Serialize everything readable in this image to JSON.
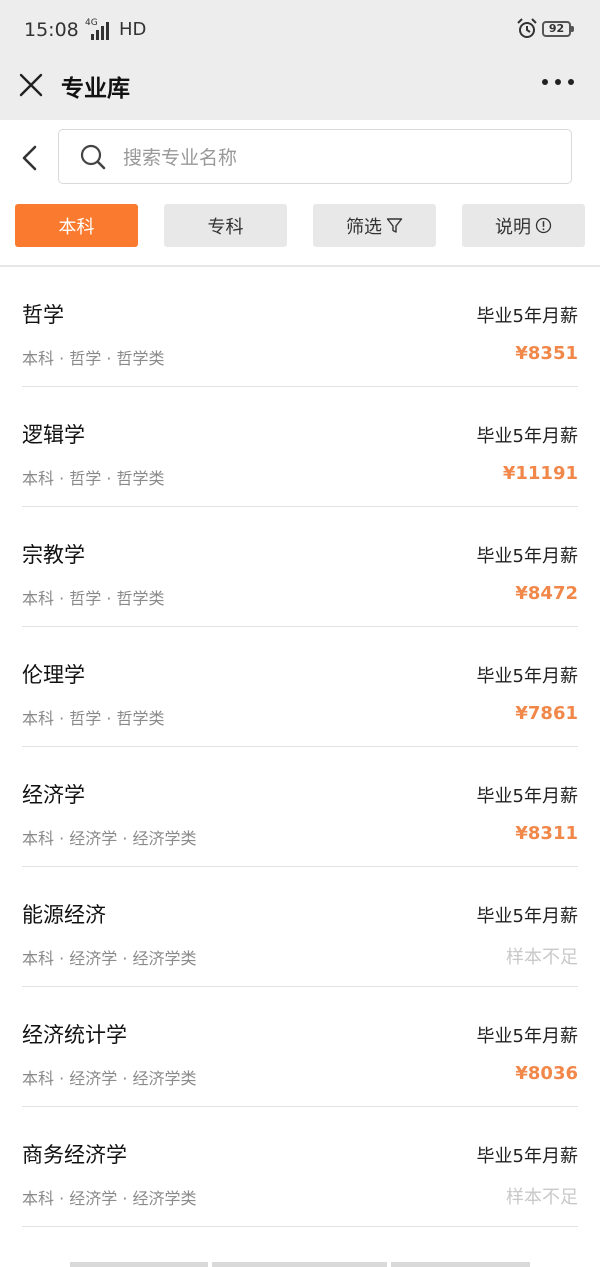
{
  "status_bar": {
    "time": "15:08",
    "network_sup": "4G",
    "network_type": "HD",
    "battery": "92"
  },
  "header": {
    "title": "专业库"
  },
  "search": {
    "placeholder": "搜索专业名称"
  },
  "filters": [
    {
      "label": "本科",
      "active": true
    },
    {
      "label": "专科",
      "active": false
    },
    {
      "label": "筛选",
      "active": false,
      "icon": "funnel-icon"
    },
    {
      "label": "说明",
      "active": false,
      "icon": "info-icon"
    }
  ],
  "majors": [
    {
      "name": "哲学",
      "meta": "本科 · 哲学 · 哲学类",
      "salary_label": "毕业5年月薪",
      "salary": "¥8351"
    },
    {
      "name": "逻辑学",
      "meta": "本科 · 哲学 · 哲学类",
      "salary_label": "毕业5年月薪",
      "salary": "¥11191"
    },
    {
      "name": "宗教学",
      "meta": "本科 · 哲学 · 哲学类",
      "salary_label": "毕业5年月薪",
      "salary": "¥8472"
    },
    {
      "name": "伦理学",
      "meta": "本科 · 哲学 · 哲学类",
      "salary_label": "毕业5年月薪",
      "salary": "¥7861"
    },
    {
      "name": "经济学",
      "meta": "本科 · 经济学 · 经济学类",
      "salary_label": "毕业5年月薪",
      "salary": "¥8311"
    },
    {
      "name": "能源经济",
      "meta": "本科 · 经济学 · 经济学类",
      "salary_label": "毕业5年月薪",
      "salary": "样本不足"
    },
    {
      "name": "经济统计学",
      "meta": "本科 · 经济学 · 经济学类",
      "salary_label": "毕业5年月薪",
      "salary": "¥8036"
    },
    {
      "name": "商务经济学",
      "meta": "本科 · 经济学 · 经济学类",
      "salary_label": "毕业5年月薪",
      "salary": "样本不足"
    }
  ],
  "colors": {
    "accent": "#fa7a2f",
    "salary": "#f2874a",
    "muted": "#c9c9c9",
    "header_bg": "#ededed"
  }
}
